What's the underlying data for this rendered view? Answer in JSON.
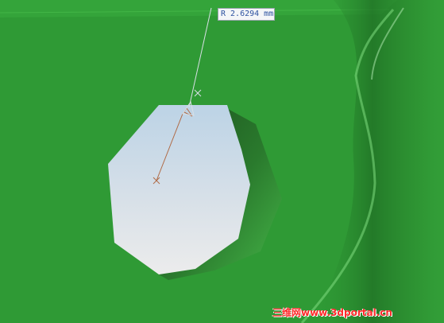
{
  "dimension": {
    "label": "R 2.6294 mm"
  },
  "watermark": {
    "text": "三维网www.3dportal.cn"
  },
  "colors": {
    "part_green": "#2f9a35",
    "hole_light": "#e6e8ea",
    "hole_blue": "#bcd3e6",
    "annotation_line": "#b06a45",
    "label_text": "#2d52a0",
    "watermark": "#ff2a2a"
  }
}
